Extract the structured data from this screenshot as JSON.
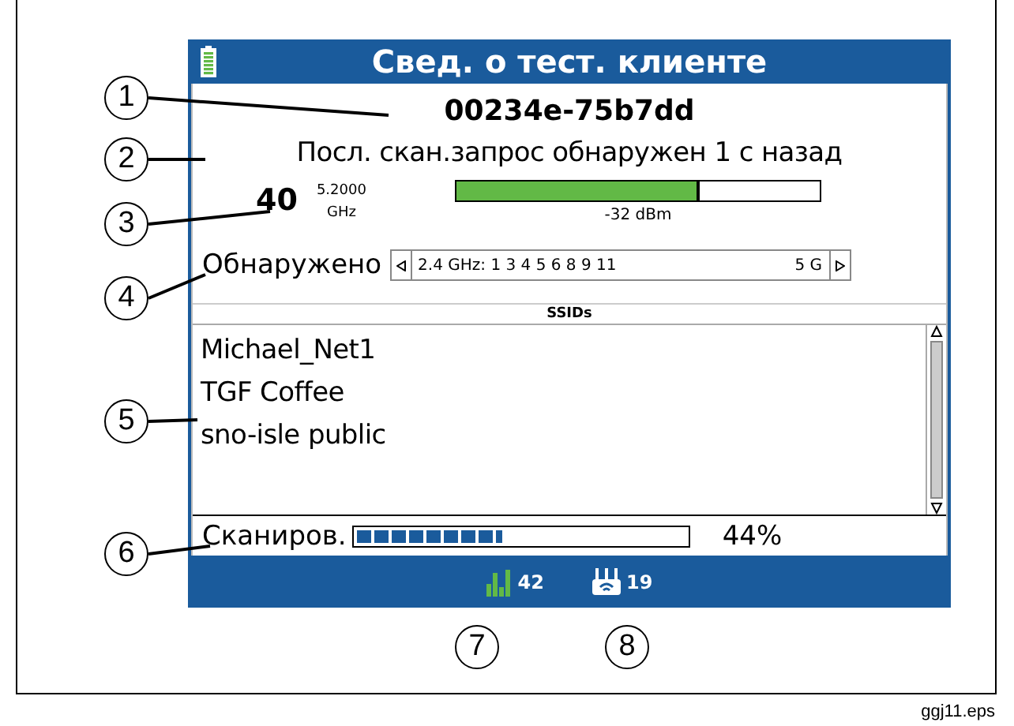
{
  "screen": {
    "title": "Свед. о тест. клиенте",
    "mac": "00234e-75b7dd",
    "last_probe": "Посл. скан.запрос обнаружен 1 с назад",
    "channel": "40",
    "frequency": "5.2000",
    "frequency_unit": "GHz",
    "signal": {
      "level": 0.67,
      "reading": "-32 dBm"
    },
    "detected_label": "Обнаружено",
    "channel_list": "2.4 GHz: 1 3 4 5 6 8 9 11",
    "channel_list_next": "5 G",
    "ssids_header": "SSIDs",
    "ssids": [
      "Michael_Net1",
      "TGF Coffee",
      "sno-isle public"
    ],
    "scan": {
      "label": "Сканиров.",
      "level": 0.44,
      "reading": "44%"
    },
    "status_bar": {
      "signals": "42",
      "access_points": "19"
    }
  },
  "callouts": [
    "1",
    "2",
    "3",
    "4",
    "5",
    "6",
    "7",
    "8"
  ],
  "caption": "ggj11.eps"
}
